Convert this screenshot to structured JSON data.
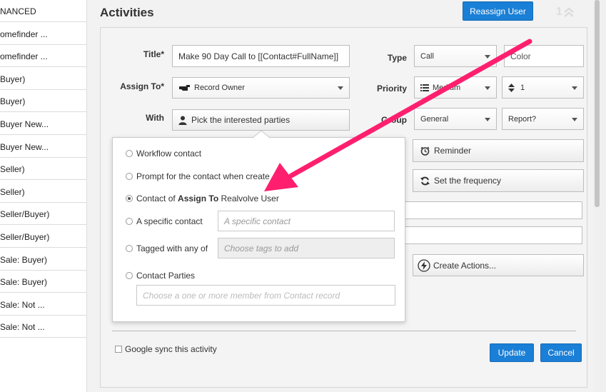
{
  "left_list": [
    "NANCED",
    "omefinder ...",
    "omefinder ...",
    "Buyer)",
    "Buyer)",
    "Buyer New...",
    "Buyer New...",
    "Seller)",
    "Seller)",
    "Seller/Buyer)",
    "Seller/Buyer)",
    "Sale: Buyer)",
    "Sale: Buyer)",
    "Sale: Not ...",
    "Sale: Not ..."
  ],
  "header": {
    "title": "Activities",
    "reassign_label": "Reassign User",
    "page_number": "1"
  },
  "form": {
    "title_label": "Title*",
    "title_value": "Make 90 Day Call to [[Contact#FullName]]",
    "assign_label": "Assign To*",
    "assign_value": "Record Owner",
    "with_label": "With",
    "with_value": "Pick the interested parties",
    "type_label": "Type",
    "type_value": "Call",
    "color_placeholder": "Color",
    "priority_label": "Priority",
    "priority_value": "Medium",
    "priority_num": "1",
    "group_label": "Group",
    "group_value": "General",
    "report_value": "Report?",
    "reminder_label": "Reminder",
    "frequency_label": "Set the frequency",
    "create_actions_label": "Create Actions...",
    "google_sync_label": "Google sync this activity",
    "update_label": "Update",
    "cancel_label": "Cancel"
  },
  "popup": {
    "workflow_contact": "Workflow contact",
    "prompt_contact": "Prompt for the contact when create",
    "contact_of_prefix": "Contact of ",
    "contact_of_bold": "Assign To",
    "contact_of_suffix": " Realvolve User",
    "specific_contact": "A specific contact",
    "specific_contact_placeholder": "A specific contact",
    "tagged_label": "Tagged with any of",
    "tags_placeholder": "Choose tags to add",
    "contact_parties": "Contact Parties",
    "parties_placeholder": "Choose a one or more member from Contact record"
  },
  "colors": {
    "primary_button": "#1a7fd6",
    "annotation_arrow": "#ff1f6e"
  },
  "icons": {
    "assign": "pointing-hand-icon",
    "with": "person-icon",
    "priority": "list-icon",
    "priority_num": "sort-icon",
    "reminder": "alarm-clock-icon",
    "frequency": "refresh-icon",
    "create_actions": "lightning-bolt-icon",
    "page": "double-chevron-up-icon"
  }
}
